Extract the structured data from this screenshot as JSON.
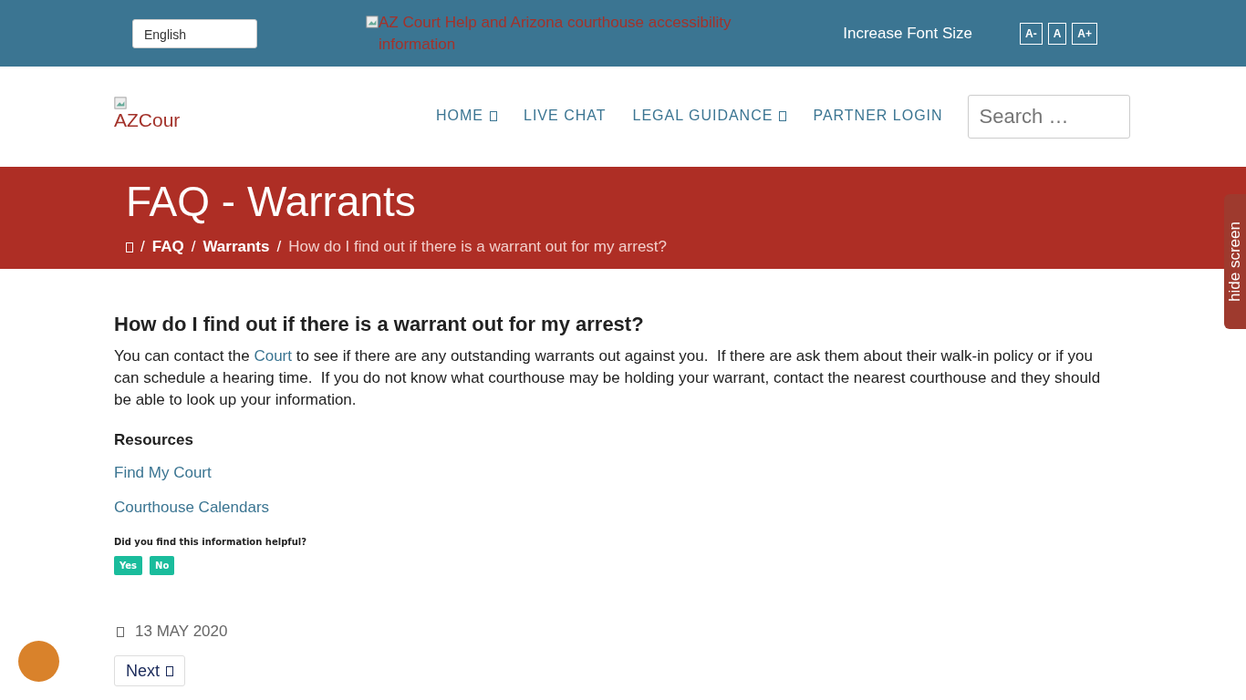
{
  "top_bar": {
    "language": "English",
    "banner_alt": "AZ Court Help and Arizona courthouse accessibility information",
    "font_label": "Increase Font Size",
    "font_buttons": [
      "A-",
      "A",
      "A+"
    ]
  },
  "header": {
    "logo_alt": "AZCour",
    "nav": [
      {
        "label": "HOME",
        "dropdown": true
      },
      {
        "label": "LIVE CHAT",
        "dropdown": false
      },
      {
        "label": "LEGAL GUIDANCE",
        "dropdown": true
      },
      {
        "label": "PARTNER LOGIN",
        "dropdown": false
      }
    ],
    "search": {
      "placeholder": "Search …"
    }
  },
  "hero": {
    "title": "FAQ - Warrants",
    "separator": "/",
    "breadcrumb": [
      {
        "label": "FAQ",
        "link": true
      },
      {
        "label": "Warrants",
        "link": true
      },
      {
        "label": "How do I find out if there is a warrant out for my arrest?",
        "link": false
      }
    ]
  },
  "side_tab": "hide screen",
  "article": {
    "question": "How do I find out if there is a warrant out for my arrest?",
    "answer_before": "You can contact the",
    "answer_link": "Court",
    "answer_after": "to see if there are any outstanding warrants out against you.  If there are ask them about their walk-in policy or if you can schedule a hearing time.  If you do not know what courthouse may be holding your warrant, contact the nearest courthouse and they should be able to look up your information.",
    "resources_heading": "Resources",
    "resources": [
      "Find My Court",
      "Courthouse Calendars"
    ],
    "feedback_question": "Did you find this information helpful?",
    "feedback_buttons": [
      "Yes",
      "No"
    ],
    "date": "13 MAY 2020",
    "next": "Next"
  }
}
